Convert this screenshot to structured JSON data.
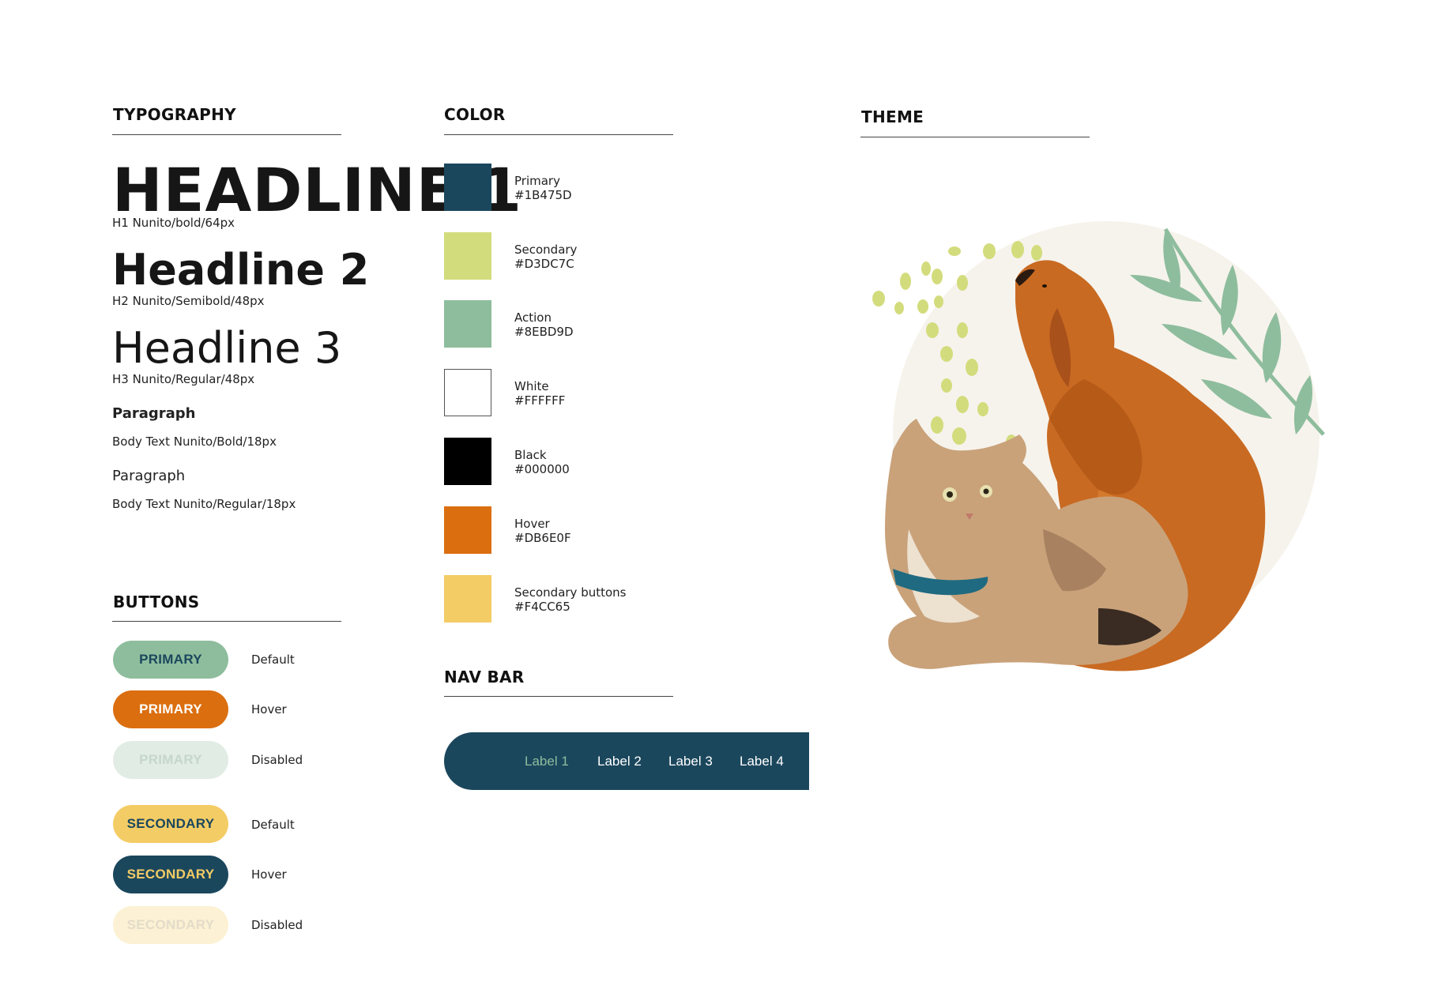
{
  "typography": {
    "title": "TYPOGRAPHY",
    "h1": {
      "text": "HEADLINE 1",
      "caption": "H1 Nunito/bold/64px"
    },
    "h2": {
      "text": "Headline 2",
      "caption": "H2 Nunito/Semibold/48px"
    },
    "h3": {
      "text": "Headline 3",
      "caption": "H3 Nunito/Regular/48px"
    },
    "paragraph_bold": {
      "text": "Paragraph",
      "caption": "Body Text Nunito/Bold/18px"
    },
    "paragraph_regular": {
      "text": "Paragraph",
      "caption": "Body Text Nunito/Regular/18px"
    }
  },
  "color": {
    "title": "COLOR",
    "swatches": [
      {
        "name": "Primary",
        "hex": "#1B475D",
        "fill": "#1B475D"
      },
      {
        "name": "Secondary",
        "hex": "#D3DC7C",
        "fill": "#D3DC7C"
      },
      {
        "name": "Action",
        "hex": "#8EBD9D",
        "fill": "#8EBD9D"
      },
      {
        "name": "White",
        "hex": "#FFFFFF",
        "fill": "#FFFFFF"
      },
      {
        "name": "Black",
        "hex": "#000000",
        "fill": "#000000"
      },
      {
        "name": "Hover",
        "hex": "#DB6E0F",
        "fill": "#DB6E0F"
      },
      {
        "name": "Secondary buttons",
        "hex": "#F4CC65",
        "fill": "#F4CC65"
      }
    ]
  },
  "theme": {
    "title": "THEME"
  },
  "buttons": {
    "title": "BUTTONS",
    "items": [
      {
        "label": "PRIMARY",
        "state": "Default",
        "bg": "#8EBD9D",
        "fg": "#1B475D"
      },
      {
        "label": "PRIMARY",
        "state": "Hover",
        "bg": "#DB6E0F",
        "fg": "#FFFFFF"
      },
      {
        "label": "PRIMARY",
        "state": "Disabled",
        "bg": "#E1ECE4",
        "fg": "#C5D6CB"
      },
      {
        "label": "SECONDARY",
        "state": "Default",
        "bg": "#F4CC65",
        "fg": "#1B475D"
      },
      {
        "label": "SECONDARY",
        "state": "Hover",
        "bg": "#1B475D",
        "fg": "#F4CC65"
      },
      {
        "label": "SECONDARY",
        "state": "Disabled",
        "bg": "#FCF1D4",
        "fg": "#E3DCC8"
      }
    ]
  },
  "nav_bar": {
    "title": "NAV BAR",
    "items": [
      {
        "label": "Label 1",
        "active": true
      },
      {
        "label": "Label 2",
        "active": false
      },
      {
        "label": "Label 3",
        "active": false
      },
      {
        "label": "Label 4",
        "active": false
      }
    ]
  }
}
